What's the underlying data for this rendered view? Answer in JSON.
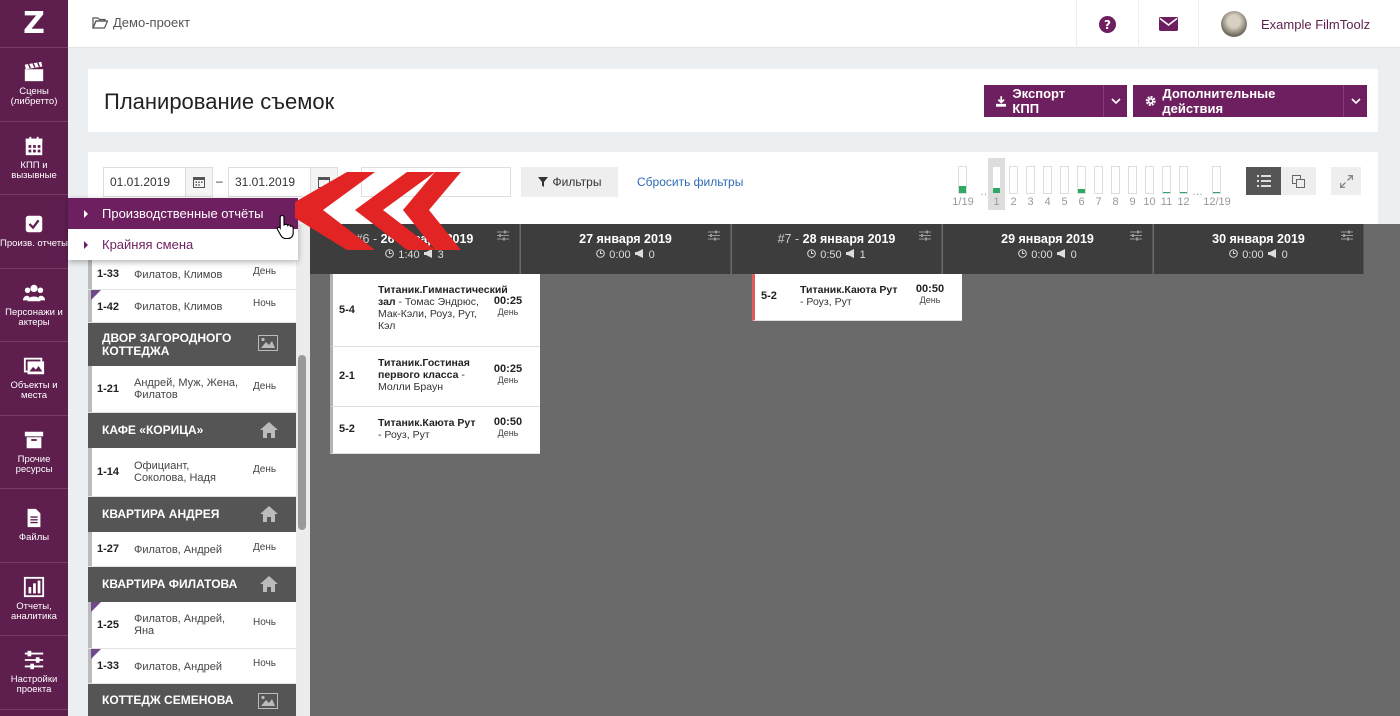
{
  "nav": {
    "logo": "Z",
    "items": [
      {
        "label": "Сцены (либретто)",
        "icon": "clapperboard-icon"
      },
      {
        "label": "КПП и вызывные",
        "icon": "calendar-icon"
      },
      {
        "label": "Произв. отчеты",
        "icon": "checkbox-icon"
      },
      {
        "label": "Персонажи и актеры",
        "icon": "people-icon"
      },
      {
        "label": "Объекты и места",
        "icon": "image-icon"
      },
      {
        "label": "Прочие ресурсы",
        "icon": "box-icon"
      },
      {
        "label": "Файлы",
        "icon": "file-icon"
      },
      {
        "label": "Отчеты, аналитика",
        "icon": "bar-chart-icon"
      },
      {
        "label": "Настройки проекта",
        "icon": "sliders-icon"
      }
    ]
  },
  "topbar": {
    "breadcrumb": "Демо-проект",
    "user_name": "Example FilmToolz"
  },
  "header": {
    "title": "Планирование съемок",
    "export_label": "Экспорт КПП",
    "more_actions_label": "Дополнительные действия"
  },
  "filters": {
    "date_from": "01.01.2019",
    "date_to": "31.01.2019",
    "date_separator": "–",
    "filters_label": "Фильтры",
    "reset_label": "Сбросить фильтры",
    "mini_days": [
      {
        "label": "1/19",
        "fill": 0.25,
        "wide": true
      },
      {
        "label": "…",
        "dots": true
      },
      {
        "label": "1",
        "fill": 0.2,
        "selected": true
      },
      {
        "label": "2",
        "fill": 0
      },
      {
        "label": "3",
        "fill": 0
      },
      {
        "label": "4",
        "fill": 0
      },
      {
        "label": "5",
        "fill": 0
      },
      {
        "label": "6",
        "fill": 0.15
      },
      {
        "label": "7",
        "fill": 0
      },
      {
        "label": "8",
        "fill": 0
      },
      {
        "label": "9",
        "fill": 0
      },
      {
        "label": "10",
        "fill": 0
      },
      {
        "label": "11",
        "fill": 0.04
      },
      {
        "label": "12",
        "fill": 0.04
      },
      {
        "label": "…",
        "dots": true
      },
      {
        "label": "12/19",
        "fill": 0.04,
        "wide": true
      }
    ]
  },
  "dropdown": {
    "items": [
      {
        "label": "Производственные отчёты",
        "active": true
      },
      {
        "label": "Крайняя смена",
        "active": false
      }
    ]
  },
  "scene_list": {
    "rows": [
      {
        "scene": "1-33",
        "chars": "Филатов, Климов",
        "tod": "День"
      },
      {
        "scene": "1-42",
        "chars": "Филатов, Климов",
        "tod": "Ночь"
      },
      {
        "location": "ДВОР ЗАГОРОДНОГО КОТТЕДЖА",
        "icon": "image-icon"
      },
      {
        "scene": "1-21",
        "chars": "Андрей, Муж, Жена, Филатов",
        "tod": "День"
      },
      {
        "location": "КАФЕ «КОРИЦА»",
        "icon": "house-icon"
      },
      {
        "scene": "1-14",
        "chars": "Официант, Соколова, Надя",
        "tod": "День"
      },
      {
        "location": "КВАРТИРА АНДРЕЯ",
        "icon": "house-icon"
      },
      {
        "scene": "1-27",
        "chars": "Филатов, Андрей",
        "tod": "День"
      },
      {
        "location": "КВАРТИРА ФИЛАТОВА",
        "icon": "house-icon"
      },
      {
        "scene": "1-25",
        "chars": "Филатов, Андрей, Яна",
        "tod": "Ночь"
      },
      {
        "scene": "1-33",
        "chars": "Филатов, Андрей",
        "tod": "Ночь"
      },
      {
        "location": "КОТТЕДЖ СЕМЕНОВА",
        "icon": "image-icon"
      }
    ]
  },
  "board": {
    "days": [
      {
        "num": "#6 -",
        "date": "26 января 2019",
        "time": "1:40",
        "count": "3"
      },
      {
        "num": "",
        "date": "27 января 2019",
        "time": "0:00",
        "count": "0"
      },
      {
        "num": "#7 -",
        "date": "28 января 2019",
        "time": "0:50",
        "count": "1"
      },
      {
        "num": "",
        "date": "29 января 2019",
        "time": "0:00",
        "count": "0"
      },
      {
        "num": "",
        "date": "30 января 2019",
        "time": "0:00",
        "count": "0"
      }
    ],
    "cards": [
      {
        "day": 0,
        "scene": "5-4",
        "set": "Титаник.Гимнастический зал",
        "chars": " - Томас Эндрюс, Мак-Кэли, Роуз, Рут, Кэл",
        "dur": "00:25",
        "tod": "День"
      },
      {
        "day": 0,
        "scene": "2-1",
        "set": "Титаник.Гостиная первого класса",
        "chars": " - Молли Браун",
        "dur": "00:25",
        "tod": "День"
      },
      {
        "day": 0,
        "scene": "5-2",
        "set": "Титаник.Каюта Рут",
        "chars": " - Роуз, Рут",
        "dur": "00:50",
        "tod": "День"
      },
      {
        "day": 2,
        "scene": "5-2",
        "set": "Титаник.Каюта Рут",
        "chars": " - Роуз, Рут",
        "dur": "00:50",
        "tod": "День"
      }
    ]
  },
  "colors": {
    "brand": "#6e1f5f",
    "nav_bg": "#5e1f4f",
    "board_bg": "#6a6a6a",
    "progress_green": "#2ea865",
    "arrow_red": "#e32424"
  }
}
